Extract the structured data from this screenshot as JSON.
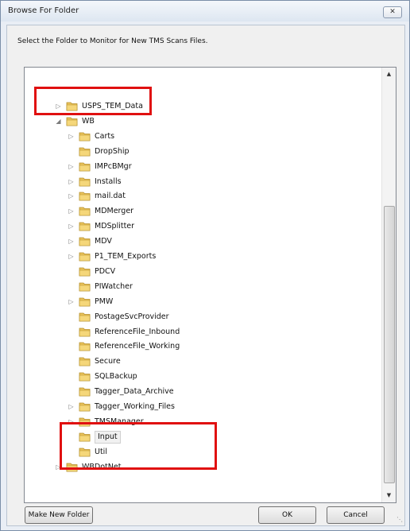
{
  "window": {
    "title": "Browse For Folder",
    "close_label": "✕"
  },
  "instruction": "Select the Folder to Monitor for New TMS Scans Files.",
  "tree": {
    "items": [
      {
        "label": "USPS_TEM_Data",
        "expander": "▷",
        "indent": 0
      },
      {
        "label": "WB",
        "expander": "◢",
        "indent": 0
      },
      {
        "label": "Carts",
        "expander": "▷",
        "indent": 1
      },
      {
        "label": "DropShip",
        "expander": "",
        "indent": 1
      },
      {
        "label": "IMPcBMgr",
        "expander": "▷",
        "indent": 1
      },
      {
        "label": "Installs",
        "expander": "▷",
        "indent": 1
      },
      {
        "label": "mail.dat",
        "expander": "▷",
        "indent": 1
      },
      {
        "label": "MDMerger",
        "expander": "▷",
        "indent": 1
      },
      {
        "label": "MDSplitter",
        "expander": "▷",
        "indent": 1
      },
      {
        "label": "MDV",
        "expander": "▷",
        "indent": 1
      },
      {
        "label": "P1_TEM_Exports",
        "expander": "▷",
        "indent": 1
      },
      {
        "label": "PDCV",
        "expander": "",
        "indent": 1
      },
      {
        "label": "PIWatcher",
        "expander": "",
        "indent": 1
      },
      {
        "label": "PMW",
        "expander": "▷",
        "indent": 1
      },
      {
        "label": "PostageSvcProvider",
        "expander": "",
        "indent": 1
      },
      {
        "label": "ReferenceFile_Inbound",
        "expander": "",
        "indent": 1
      },
      {
        "label": "ReferenceFile_Working",
        "expander": "",
        "indent": 1
      },
      {
        "label": "Secure",
        "expander": "",
        "indent": 1
      },
      {
        "label": "SQLBackup",
        "expander": "",
        "indent": 1
      },
      {
        "label": "Tagger_Data_Archive",
        "expander": "",
        "indent": 1
      },
      {
        "label": "Tagger_Working_Files",
        "expander": "▷",
        "indent": 1
      },
      {
        "label": "TMSManager",
        "expander": "▷",
        "indent": 1
      },
      {
        "label": "Input",
        "expander": "",
        "indent": 1,
        "selected": true
      },
      {
        "label": "Util",
        "expander": "",
        "indent": 1
      },
      {
        "label": "WBDotNet",
        "expander": "▷",
        "indent": 0
      }
    ]
  },
  "scrollbar": {
    "up": "▲",
    "down": "▼"
  },
  "buttons": {
    "make_new_folder": "Make New Folder",
    "ok": "OK",
    "cancel": "Cancel"
  },
  "colors": {
    "highlight": "#e01010",
    "folder": "#e9c25a"
  }
}
